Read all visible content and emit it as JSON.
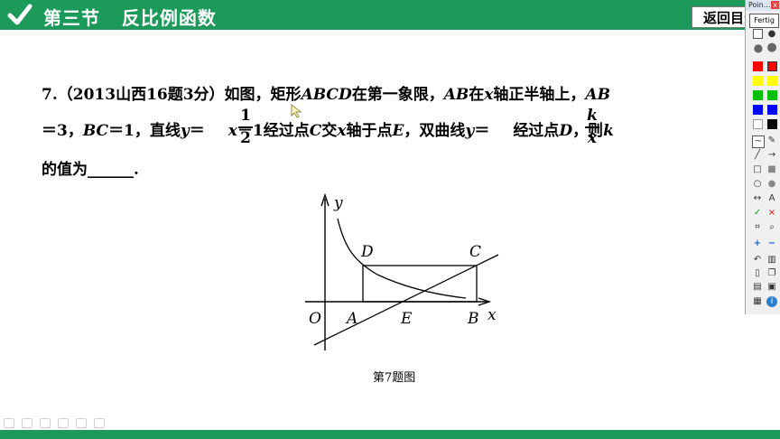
{
  "header": {
    "title": "第三节   反比例函数",
    "back_button": "返回目录",
    "background_color": "#1b9a5a"
  },
  "question": {
    "number": "7.",
    "line1_a": "（2013山西16题3分）如图，矩形",
    "line1_b": "ABCD",
    "line1_c": "在第一象限，",
    "line1_d": "AB",
    "line1_e": "在",
    "line1_f": "x",
    "line1_g": "轴正半轴上，",
    "line1_h": "AB",
    "line2_a": "＝3，",
    "line2_b": "BC",
    "line2_c": "＝1，直线",
    "line2_d": "y",
    "line2_e": "＝",
    "frac1_num": "1",
    "frac1_den": "2",
    "line2_f": "x",
    "line2_g": "－1经过点",
    "line2_h": "C",
    "line2_i": "交",
    "line2_j": "x",
    "line2_k": "轴于点",
    "line2_l": "E",
    "line2_m": "，双曲线",
    "line2_n": "y",
    "line2_o": "＝",
    "frac2_num": "k",
    "frac2_den": "x",
    "line2_p": "经过点",
    "line2_q": "D",
    "line2_r": "，则",
    "line2_s": "k",
    "line3": "的值为______."
  },
  "figure": {
    "caption": "第7题图",
    "labels": {
      "y": "y",
      "x": "x",
      "O": "O",
      "A": "A",
      "E": "E",
      "B": "B",
      "C": "C",
      "D": "D"
    }
  },
  "tool_panel": {
    "title": "Poin...",
    "close": "x",
    "fertig": "Fertig",
    "colors": [
      "#ff0000",
      "#ff0000",
      "#ffff00",
      "#ffff00",
      "#00c000",
      "#00c000",
      "#0000ff",
      "#0000ff",
      "#ffffff",
      "#000000"
    ],
    "tools": [
      "curve-icon",
      "pen-icon",
      "line-icon",
      "arrow-icon",
      "rect-icon",
      "filled-rect-icon",
      "ellipse-icon",
      "filled-ellipse-icon",
      "double-arrow-icon",
      "text-icon",
      "check-icon",
      "cross-icon",
      "crop-icon",
      "zoom-icon",
      "plus-icon",
      "minus-icon",
      "undo-icon",
      "trash-icon",
      "new-page-icon",
      "copy-icon",
      "print-icon",
      "save-icon",
      "settings-icon",
      "info-icon"
    ],
    "text_tool": "A",
    "check": "✓",
    "cross": "×",
    "plus": "+",
    "minus": "−",
    "info": "i"
  }
}
